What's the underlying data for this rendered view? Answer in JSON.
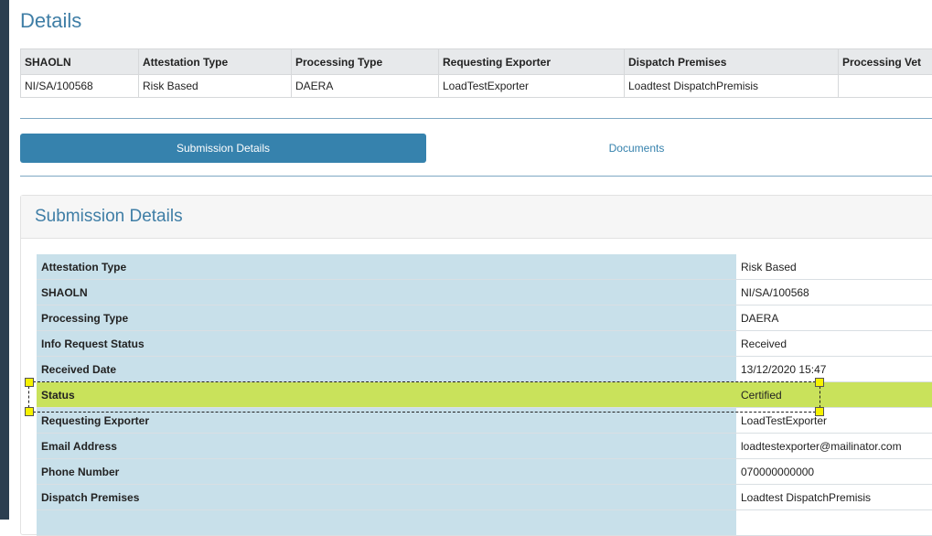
{
  "page": {
    "title": "Details"
  },
  "summary_table": {
    "headers": [
      "SHAOLN",
      "Attestation Type",
      "Processing Type",
      "Requesting Exporter",
      "Dispatch Premises",
      "Processing Vet"
    ],
    "row": [
      "NI/SA/100568",
      "Risk Based",
      "DAERA",
      "LoadTestExporter",
      "Loadtest DispatchPremisis",
      ""
    ]
  },
  "tabs": {
    "submission_details": "Submission Details",
    "documents": "Documents"
  },
  "panel": {
    "title": "Submission Details",
    "rows": [
      {
        "label": "Attestation Type",
        "value": "Risk Based"
      },
      {
        "label": "SHAOLN",
        "value": "NI/SA/100568"
      },
      {
        "label": "Processing Type",
        "value": "DAERA"
      },
      {
        "label": "Info Request Status",
        "value": "Received"
      },
      {
        "label": "Received Date",
        "value": "13/12/2020 15:47"
      },
      {
        "label": "Status",
        "value": "Certified"
      },
      {
        "label": "Requesting Exporter",
        "value": "LoadTestExporter"
      },
      {
        "label": "Email Address",
        "value": "loadtestexporter@mailinator.com"
      },
      {
        "label": "Phone Number",
        "value": "070000000000"
      },
      {
        "label": "Dispatch Premises",
        "value": "Loadtest DispatchPremisis"
      }
    ]
  },
  "highlight": {
    "color": "#c9e25b",
    "handle_color": "#f6f200"
  },
  "colors": {
    "accent": "#3682ad",
    "title": "#3f7ea6",
    "label_bg": "#c8e0ea",
    "header_bg": "#e7e9eb"
  }
}
